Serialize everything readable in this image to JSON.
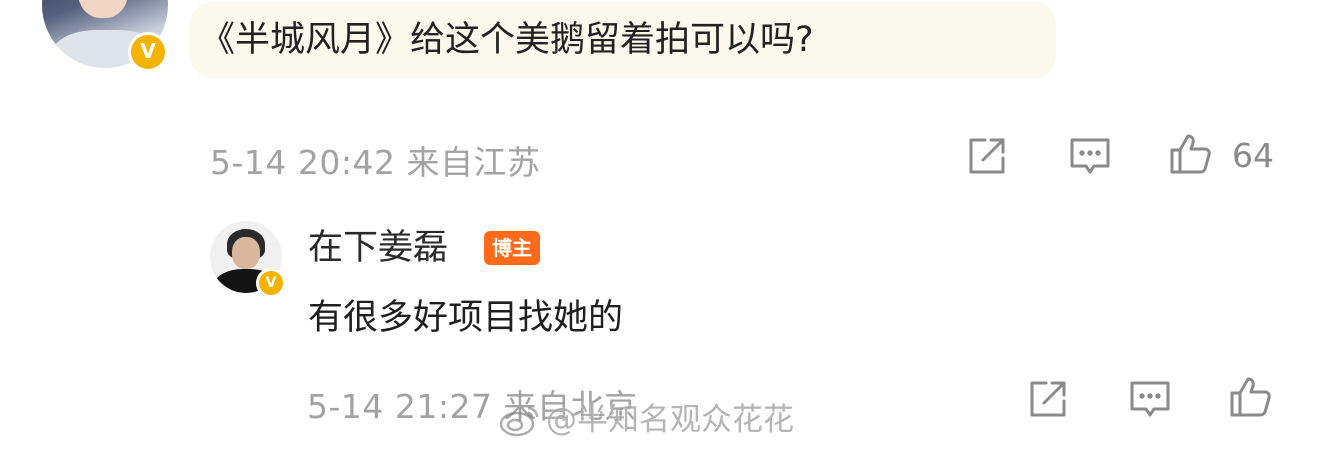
{
  "top_comment": {
    "text": "《半城风月》给这个美鹅留着拍可以吗?",
    "meta": "5-14 20:42 来自江苏",
    "verified_badge": "V",
    "likes": "64",
    "icons": [
      "share-icon",
      "comment-icon",
      "like-icon"
    ]
  },
  "reply": {
    "username": "在下姜磊",
    "role_badge": "博主",
    "verified_badge": "V",
    "text": "有很多好项目找她的",
    "meta": "5-14 21:27 来自北京",
    "icons": [
      "share-icon",
      "comment-icon",
      "like-icon"
    ]
  },
  "watermark": {
    "text": "@半知名观众花花",
    "icon": "weibo-logo-icon"
  },
  "colors": {
    "bubble_bg": "#fbf8ec",
    "meta_gray": "#a3a3a3",
    "verified_gold": "#f5b300",
    "role_orange": "#ff6a1a"
  }
}
